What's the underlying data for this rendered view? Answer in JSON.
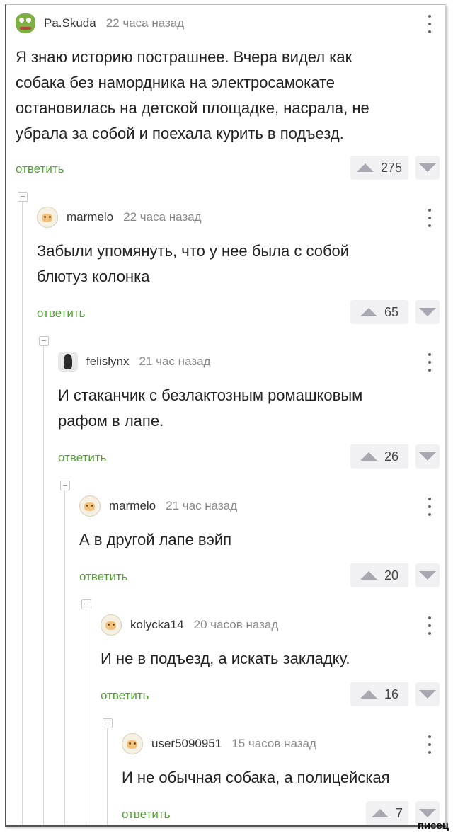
{
  "comments": [
    {
      "author": "Pa.Skuda",
      "time": "22 часа назад",
      "avatar": "frog-avatar",
      "lines": [
        "Я знаю историю пострашнее. Вчера видел как",
        "собака без намордника на электросамокате",
        "остановилась на детской площадке, насрала, не",
        "убрала за собой и поехала курить в подъезд."
      ],
      "reply": "ответить",
      "rating": "275"
    },
    {
      "author": "marmelo",
      "time": "22 часа назад",
      "avatar": "smile-avatar",
      "lines": [
        "Забыли упомянуть, что у нее была с собой",
        "блютуз колонка"
      ],
      "reply": "ответить",
      "rating": "65"
    },
    {
      "author": "felislynx",
      "time": "21 час назад",
      "avatar": "dark-avatar",
      "lines": [
        "И стаканчик с безлактозным ромашковым",
        "рафом в лапе."
      ],
      "reply": "ответить",
      "rating": "26"
    },
    {
      "author": "marmelo",
      "time": "21 час назад",
      "avatar": "smile-avatar",
      "lines": [
        "А в другой лапе вэйп"
      ],
      "reply": "ответить",
      "rating": "20"
    },
    {
      "author": "kolycka14",
      "time": "20 часов назад",
      "avatar": "smile-avatar",
      "lines": [
        "И не в подъезд, а искать закладку."
      ],
      "reply": "ответить",
      "rating": "16"
    },
    {
      "author": "user5090951",
      "time": "15 часов назад",
      "avatar": "smile-avatar",
      "lines": [
        "И не обычная собака, а полицейская"
      ],
      "reply": "ответить",
      "rating": "7"
    }
  ],
  "watermark": "писец",
  "colors": {
    "reply": "#4ea42e",
    "vote_bg": "#f1f1f3",
    "vote_arrow": "#a8a8b2"
  }
}
